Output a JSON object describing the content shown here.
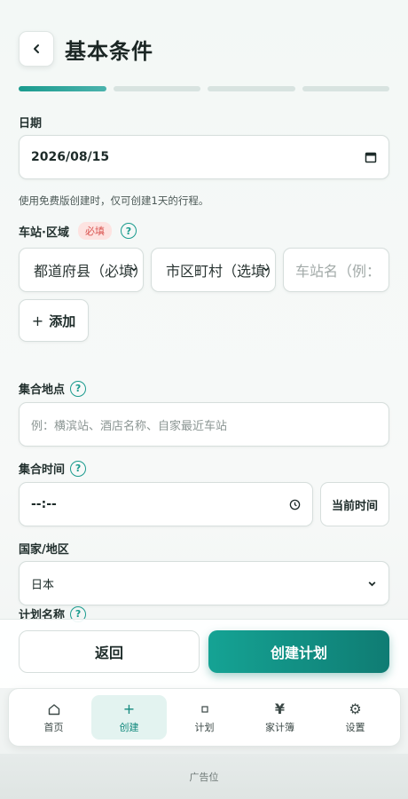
{
  "header": {
    "title": "基本条件"
  },
  "progress": {
    "total_steps": 4,
    "current_step": 1
  },
  "date": {
    "label": "日期",
    "value": "2026/08/15"
  },
  "hint": "使用免费版创建时，仅可创建1天的行程。",
  "station": {
    "label": "车站·区域",
    "required": "必填",
    "prefecture_select": "都道府县（必填）",
    "city_select": "市区町村（选填）",
    "station_placeholder": "车站名（例：",
    "add_button": "添加"
  },
  "meeting_place": {
    "label": "集合地点",
    "placeholder": "例：横滨站、酒店名称、自家最近车站"
  },
  "meeting_time": {
    "label": "集合时间",
    "value": "--:--",
    "now_button": "当前时间"
  },
  "country": {
    "label": "国家/地区",
    "value": "日本"
  },
  "plan_name": {
    "label": "计划名称"
  },
  "actions": {
    "back": "返回",
    "create": "创建计划"
  },
  "tabs": [
    {
      "label": "首页",
      "icon": "home-icon"
    },
    {
      "label": "创建",
      "icon": "plus-icon"
    },
    {
      "label": "计划",
      "icon": "square-icon"
    },
    {
      "label": "家计簿",
      "icon": "yen-icon"
    },
    {
      "label": "设置",
      "icon": "gear-icon"
    }
  ],
  "ad": "广告位",
  "colors": {
    "accent": "#1a9b8e",
    "required": "#d9534f"
  }
}
